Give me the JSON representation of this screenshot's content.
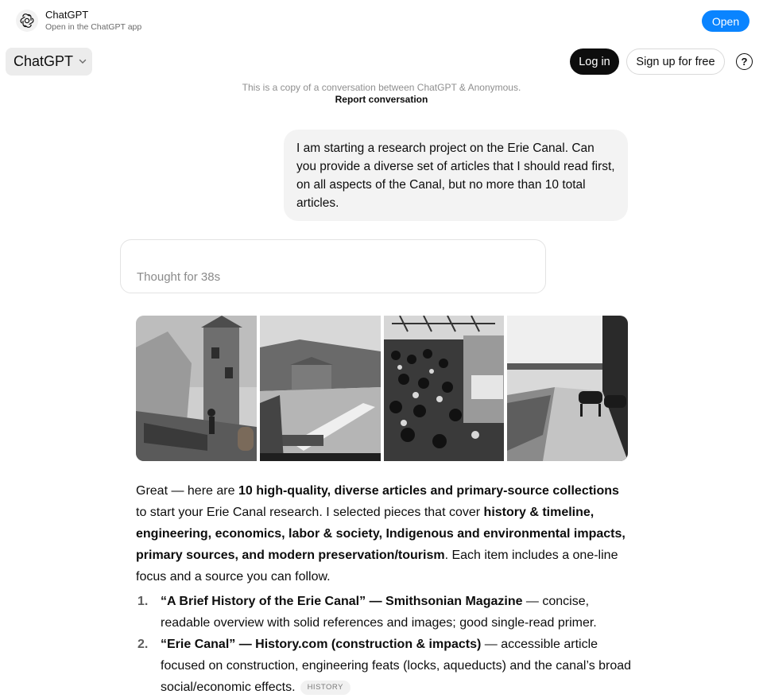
{
  "banner": {
    "app_name": "ChatGPT",
    "subtitle": "Open in the ChatGPT app",
    "open_label": "Open",
    "logo_icon": "openai-logo-icon"
  },
  "header": {
    "model_label": "ChatGPT",
    "login_label": "Log in",
    "signup_label": "Sign up for free",
    "help_glyph": "?"
  },
  "notice": {
    "copy_text": "This is a copy of a conversation between ChatGPT & Anonymous.",
    "report_label": "Report conversation"
  },
  "user_message": "I am starting a research project on the Erie Canal. Can you provide a diverse set of articles that I should read first, on all aspects of the Canal, but no more than 10 total articles.",
  "thought": {
    "label": "Thought for 38s"
  },
  "images": [
    {
      "name": "engraving-lock-house"
    },
    {
      "name": "canal-aqueduct-river"
    },
    {
      "name": "crowd-at-canal-boat"
    },
    {
      "name": "towpath-horses-bridge"
    }
  ],
  "answer": {
    "p1": "Great — here are ",
    "b1": "10 high-quality, diverse articles and primary-source collections",
    "p2": " to start your Erie Canal research. I selected pieces that cover ",
    "b2": "history & timeline, engineering, economics, labor & society, Indigenous and environmental impacts, primary sources, and modern preservation/tourism",
    "p3": ". Each item includes a one-line focus and a source you can follow."
  },
  "articles": [
    {
      "num": "1.",
      "title": "“A Brief History of the Erie Canal” — Smithsonian Magazine",
      "desc": " — concise, readable overview with solid references and images; good single-read primer.",
      "tag": ""
    },
    {
      "num": "2.",
      "title": "“Erie Canal” — History.com (construction & impacts)",
      "desc": " — accessible article focused on construction, engineering feats (locks, aqueducts) and the canal’s broad social/economic effects.",
      "tag": "HISTORY"
    }
  ]
}
